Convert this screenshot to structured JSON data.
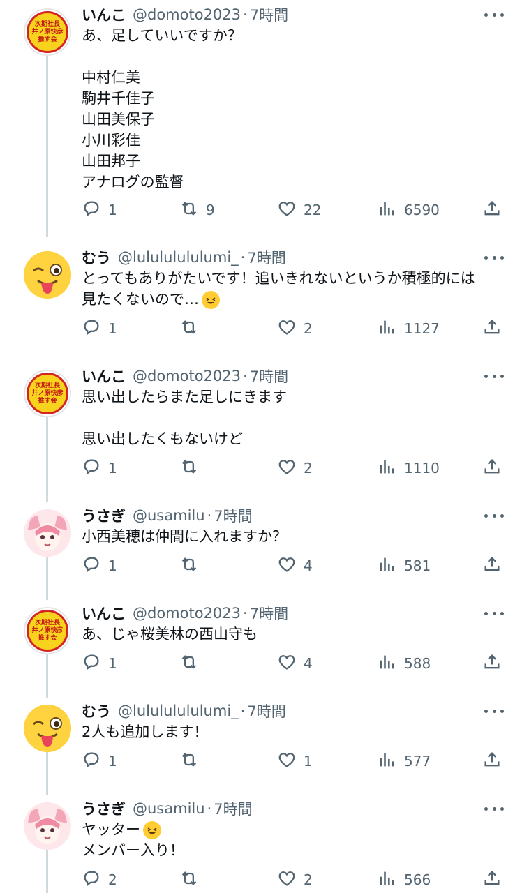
{
  "tweets": [
    {
      "name": "いんこ",
      "handle": "@domoto2023",
      "time": "7時間",
      "avatar": "inko",
      "lines": [
        "あ、足していいですか？",
        "",
        "中村仁美",
        "駒井千佳子",
        "山田美保子",
        "小川彩佳",
        "山田邦子",
        "アナログの監督"
      ],
      "replies": "1",
      "retweets": "9",
      "likes": "22",
      "views": "6590"
    },
    {
      "name": "むう",
      "handle": "@lulululululumi_",
      "time": "7時間",
      "avatar": "muu",
      "lines": [
        "とってもありがたいです！追いきれないというか積極的には",
        "見たくないので…"
      ],
      "emoji_line": 1,
      "emoji_name": "sweat-face-emoji",
      "replies": "1",
      "retweets": "",
      "likes": "2",
      "views": "1127"
    },
    {
      "name": "いんこ",
      "handle": "@domoto2023",
      "time": "7時間",
      "avatar": "inko",
      "lines": [
        "思い出したらまた足しにきます",
        "",
        "思い出したくもないけど"
      ],
      "replies": "1",
      "retweets": "",
      "likes": "2",
      "views": "1110"
    },
    {
      "name": "うさぎ",
      "handle": "@usamilu",
      "time": "7時間",
      "avatar": "usagi",
      "lines": [
        "小西美穂は仲間に入れますか？"
      ],
      "replies": "1",
      "retweets": "",
      "likes": "4",
      "views": "581"
    },
    {
      "name": "いんこ",
      "handle": "@domoto2023",
      "time": "7時間",
      "avatar": "inko",
      "lines": [
        "あ、じゃ桜美林の西山守も"
      ],
      "replies": "1",
      "retweets": "",
      "likes": "4",
      "views": "588"
    },
    {
      "name": "むう",
      "handle": "@lulululululumi_",
      "time": "7時間",
      "avatar": "muu",
      "lines": [
        "2人も追加します！"
      ],
      "replies": "1",
      "retweets": "",
      "likes": "1",
      "views": "577"
    },
    {
      "name": "うさぎ",
      "handle": "@usamilu",
      "time": "7時間",
      "avatar": "usagi",
      "lines": [
        "ヤッター",
        "メンバー入り！"
      ],
      "emoji_line": 0,
      "emoji_name": "grinning-squint-emoji",
      "replies": "2",
      "retweets": "",
      "likes": "2",
      "views": "566"
    }
  ],
  "avatar_badge_text": [
    "次期社長",
    "井ノ原快彦",
    "推す会"
  ],
  "colors": {
    "text": "#0f1419",
    "secondary": "#536471",
    "thread_line": "#cfd9de",
    "badge_yellow": "#f7d31e",
    "badge_red": "#d42424"
  }
}
